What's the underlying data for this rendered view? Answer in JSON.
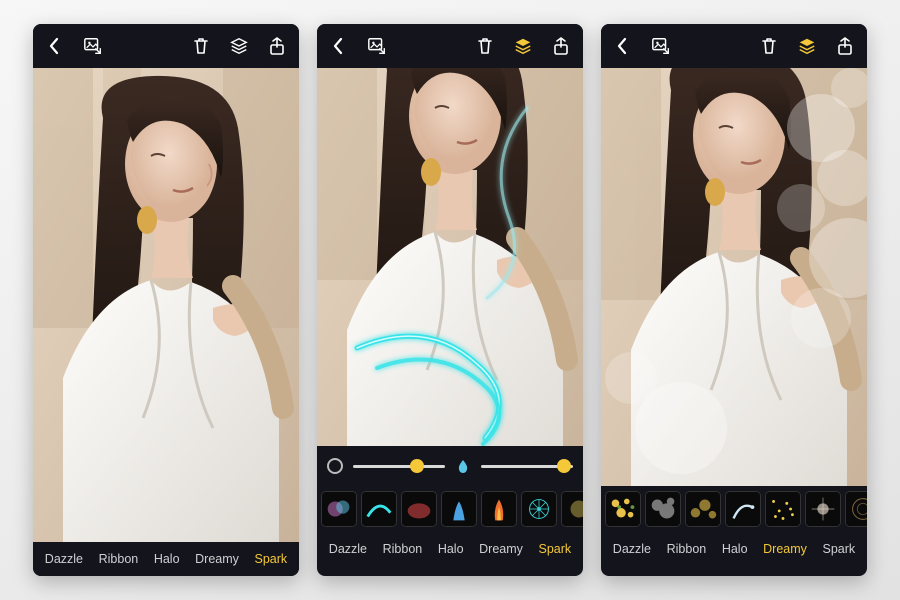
{
  "colors": {
    "accent": "#f4c838",
    "bg_dark": "#14151c",
    "text": "#cfd0d4",
    "neon": "#38e4e8"
  },
  "tabs": [
    "Dazzle",
    "Ribbon",
    "Halo",
    "Dreamy",
    "Spark"
  ],
  "screens": [
    {
      "id": "screen-1",
      "topbar_active": "none",
      "has_sliders": false,
      "has_effects_strip": false,
      "active_tab": "Spark",
      "overlay": "none"
    },
    {
      "id": "screen-2",
      "topbar_active": "layers",
      "has_sliders": true,
      "has_effects_strip": true,
      "active_tab": "Spark",
      "overlay": "neon-lines",
      "slider1": {
        "value": 70
      },
      "slider2": {
        "value": 90
      },
      "effects_set": "spark"
    },
    {
      "id": "screen-3",
      "topbar_active": "layers",
      "has_sliders": false,
      "has_effects_strip": true,
      "active_tab": "Dreamy",
      "overlay": "bokeh",
      "effects_set": "dreamy"
    }
  ]
}
